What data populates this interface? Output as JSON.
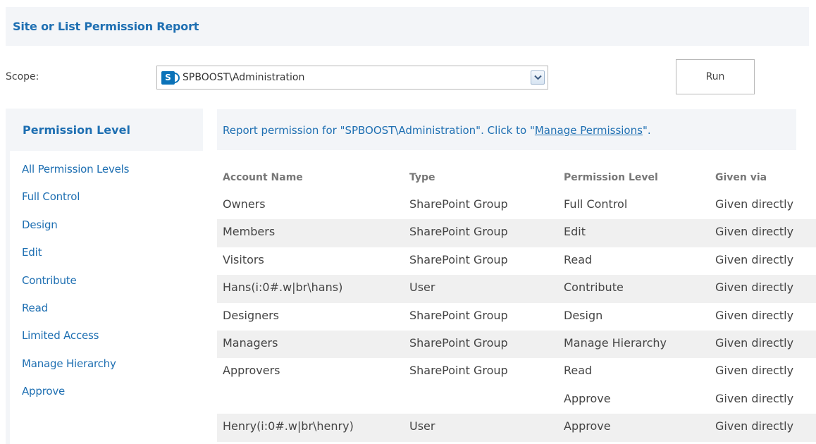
{
  "header": {
    "title": "Site or List Permission Report"
  },
  "scope": {
    "label": "Scope:",
    "value": "SPBOOST\\Administration",
    "logo_letter": "S",
    "run_label": "Run"
  },
  "sidebar": {
    "heading": "Permission Level",
    "items": [
      "All Permission Levels",
      "Full Control",
      "Design",
      "Edit",
      "Contribute",
      "Read",
      "Limited Access",
      "Manage Hierarchy",
      "Approve"
    ]
  },
  "report": {
    "prefix": "Report permission for \"SPBOOST\\Administration\". Click to \"",
    "link": "Manage Permissions",
    "suffix": "\"."
  },
  "table": {
    "headers": [
      "Account Name",
      "Type",
      "Permission Level",
      "Given via"
    ],
    "rows": [
      [
        "Owners",
        "SharePoint Group",
        "Full Control",
        "Given directly"
      ],
      [
        "Members",
        "SharePoint Group",
        "Edit",
        "Given directly"
      ],
      [
        "Visitors",
        "SharePoint Group",
        "Read",
        "Given directly"
      ],
      [
        "Hans(i:0#.w|br\\hans)",
        "User",
        "Contribute",
        "Given directly"
      ],
      [
        "Designers",
        "SharePoint Group",
        "Design",
        "Given directly"
      ],
      [
        "Managers",
        "SharePoint Group",
        "Manage Hierarchy",
        "Given directly"
      ],
      [
        "Approvers",
        "SharePoint Group",
        "Read",
        "Given directly"
      ],
      [
        "",
        "",
        "Approve",
        "Given directly"
      ],
      [
        "Henry(i:0#.w|br\\henry)",
        "User",
        "Approve",
        "Given directly"
      ]
    ]
  },
  "colors": {
    "link": "#1e6fb2",
    "panel_bg": "#f3f5f8",
    "row_shade": "#f0f0f0",
    "sharepoint_blue": "#0a72b8"
  }
}
